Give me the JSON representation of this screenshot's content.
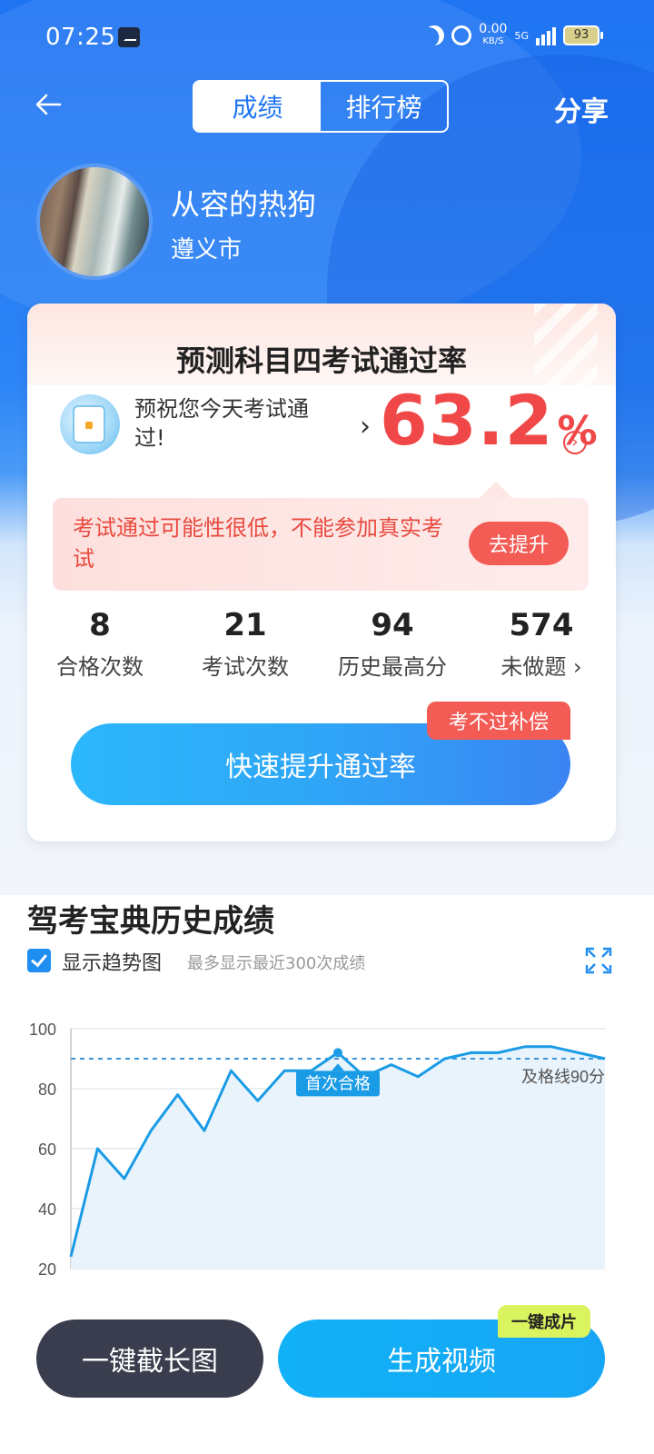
{
  "status_bar": {
    "time": "07:25",
    "net_speed": "0.00",
    "net_unit": "KB/S",
    "network": "5G",
    "battery": "93"
  },
  "nav": {
    "back_icon": "arrow-left-icon",
    "tabs": [
      {
        "label": "成绩",
        "active": true
      },
      {
        "label": "排行榜",
        "active": false
      }
    ],
    "share_label": "分享"
  },
  "profile": {
    "name": "从容的热狗",
    "city": "遵义市"
  },
  "prediction": {
    "title": "预测科目四考试通过率",
    "wish_text": "预祝您今天考试通过!",
    "pass_rate": "63.2",
    "pass_rate_unit": "%",
    "warning": "考试通过可能性很低，不能参加真实考试",
    "improve_label": "去提升"
  },
  "stats": [
    {
      "value": "8",
      "label": "合格次数"
    },
    {
      "value": "21",
      "label": "考试次数"
    },
    {
      "value": "94",
      "label": "历史最高分"
    },
    {
      "value": "574",
      "label": "未做题"
    }
  ],
  "boost": {
    "badge": "考不过补偿",
    "label": "快速提升通过率"
  },
  "history": {
    "title": "驾考宝典历史成绩",
    "trend_label": "显示趋势图",
    "trend_checked": true,
    "hint": "最多显示最近300次成绩"
  },
  "chart_data": {
    "type": "area",
    "ylim": [
      20,
      100
    ],
    "yticks": [
      "100",
      "80",
      "60",
      "40",
      "20"
    ],
    "values": [
      24,
      60,
      50,
      66,
      78,
      66,
      86,
      76,
      86,
      86,
      92,
      84,
      88,
      84,
      90,
      92,
      92,
      94,
      94,
      92,
      90
    ],
    "pass_line": 90,
    "pass_line_label": "及格线90分",
    "first_pass_index": 10,
    "first_pass_label": "首次合格",
    "grid": true,
    "line_color": "#1a9be6",
    "fill_color": "#e7f2fb"
  },
  "actions": {
    "screenshot_label": "一键截长图",
    "video_label": "生成视频",
    "video_tag": "一键成片"
  },
  "colors": {
    "primary_blue": "#1f74f2",
    "accent_red": "#f04848"
  }
}
